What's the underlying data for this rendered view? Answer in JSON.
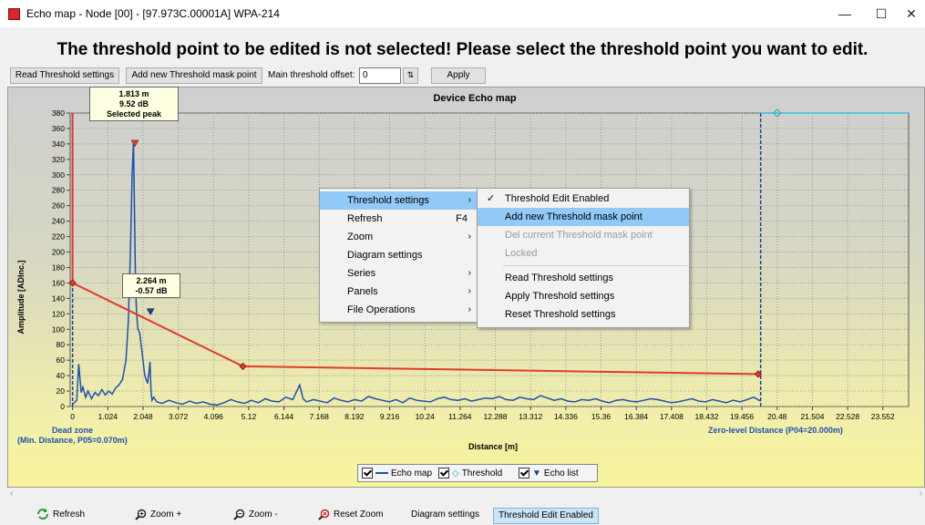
{
  "window": {
    "title": "Echo map - Node [00] - [97.973C.00001A] WPA-214",
    "minimize_glyph": "—",
    "maximize_glyph": "☐",
    "close_glyph": "✕"
  },
  "banner": "The threshold point to be edited is not selected! Please select the threshold point you want to edit.",
  "toolbar": {
    "read_threshold": "Read Threshold settings",
    "add_mask_point": "Add new Threshold mask point",
    "offset_label": "Main threshold offset:",
    "offset_value": "0",
    "apply": "Apply"
  },
  "chart_labels": {
    "dead_zone": "Dead zone",
    "min_distance": "(Min. Distance, P05=0.070m)",
    "zero_level": "Zero-level Distance (P04=20.000m)",
    "selected_peak": {
      "distance": "1.813 m",
      "level": "9.52 dB",
      "caption": "Selected peak"
    },
    "second_peak": {
      "distance": "2.264 m",
      "level": "-0.57 dB"
    }
  },
  "chart_data": {
    "type": "line",
    "title": "Device Echo map",
    "xlabel": "Distance [m]",
    "ylabel": "Amplitude [ADInc.]",
    "xlim": [
      -0.07,
      24.3
    ],
    "ylim": [
      0,
      380
    ],
    "x_ticks": [
      "0",
      "1.024",
      "2.048",
      "3.072",
      "4.096",
      "5.12",
      "6.144",
      "7.168",
      "8.192",
      "9.216",
      "10.24",
      "11.264",
      "12.288",
      "13.312",
      "14.336",
      "15.36",
      "16.384",
      "17.408",
      "18.432",
      "19.456",
      "20.48",
      "21.504",
      "22.528",
      "23.552"
    ],
    "y_ticks": [
      "0",
      "20",
      "40",
      "60",
      "80",
      "100",
      "120",
      "140",
      "160",
      "180",
      "200",
      "220",
      "240",
      "260",
      "280",
      "300",
      "320",
      "340",
      "360",
      "380"
    ],
    "grid": true,
    "series": [
      {
        "name": "Echo map",
        "color": "#1f4fb0",
        "x": [
          0.0,
          0.12,
          0.18,
          0.25,
          0.3,
          0.38,
          0.45,
          0.55,
          0.65,
          0.75,
          0.85,
          0.95,
          1.05,
          1.15,
          1.25,
          1.35,
          1.45,
          1.55,
          1.62,
          1.68,
          1.73,
          1.77,
          1.8,
          1.83,
          1.86,
          1.9,
          1.95,
          2.02,
          2.1,
          2.18,
          2.22,
          2.25,
          2.28,
          2.31,
          2.36,
          2.45,
          2.6,
          2.8,
          3.0,
          3.2,
          3.4,
          3.6,
          3.8,
          4.0,
          4.2,
          4.4,
          4.6,
          4.8,
          5.0,
          5.2,
          5.4,
          5.6,
          5.8,
          6.0,
          6.2,
          6.4,
          6.6,
          6.7,
          6.8,
          7.0,
          7.2,
          7.4,
          7.6,
          7.8,
          8.0,
          8.2,
          8.4,
          8.6,
          8.8,
          9.0,
          9.2,
          9.4,
          9.6,
          9.8,
          10.0,
          10.2,
          10.4,
          10.6,
          10.8,
          11.0,
          11.2,
          11.4,
          11.6,
          11.8,
          12.0,
          12.2,
          12.4,
          12.6,
          12.8,
          13.0,
          13.2,
          13.4,
          13.6,
          13.8,
          14.0,
          14.2,
          14.4,
          14.6,
          14.8,
          15.0,
          15.2,
          15.4,
          15.6,
          15.8,
          16.0,
          16.2,
          16.4,
          16.6,
          16.8,
          17.0,
          17.2,
          17.4,
          17.6,
          17.8,
          18.0,
          18.2,
          18.4,
          18.6,
          18.8,
          19.0,
          19.2,
          19.4,
          19.6,
          19.8,
          20.0
        ],
        "y": [
          3,
          8,
          55,
          18,
          25,
          12,
          20,
          10,
          18,
          14,
          22,
          15,
          20,
          16,
          24,
          28,
          35,
          60,
          110,
          200,
          300,
          345,
          250,
          160,
          120,
          100,
          95,
          70,
          40,
          30,
          45,
          58,
          20,
          8,
          12,
          6,
          4,
          8,
          5,
          3,
          7,
          4,
          6,
          3,
          2,
          5,
          9,
          6,
          4,
          8,
          5,
          10,
          7,
          6,
          12,
          9,
          28,
          10,
          6,
          9,
          7,
          5,
          11,
          8,
          6,
          9,
          7,
          13,
          10,
          8,
          6,
          9,
          5,
          11,
          8,
          7,
          6,
          10,
          12,
          9,
          8,
          10,
          7,
          9,
          11,
          10,
          13,
          9,
          8,
          12,
          10,
          9,
          14,
          11,
          8,
          10,
          7,
          6,
          9,
          8,
          10,
          7,
          5,
          8,
          9,
          7,
          6,
          8,
          10,
          9,
          7,
          5,
          6,
          8,
          10,
          7,
          6,
          9,
          7,
          5,
          8,
          6,
          9,
          12,
          7
        ]
      },
      {
        "name": "Threshold",
        "color": "#e23b2b",
        "x": [
          0.0,
          4.95,
          19.93
        ],
        "y": [
          160,
          52,
          42
        ]
      },
      {
        "name": "Echo list",
        "color": "#1f3f8f",
        "x": [
          1.813,
          2.264
        ],
        "y": [
          340,
          122
        ]
      }
    ],
    "annotations": [
      "1.813 m 9.52 dB Selected peak",
      "2.264 m -0.57 dB"
    ],
    "legend": {
      "position": "bottom-center",
      "entries": [
        "Echo map",
        "Threshold",
        "Echo list"
      ]
    }
  },
  "context_menu": {
    "items": [
      {
        "label": "Threshold settings",
        "arrow": "›",
        "highlighted": true
      },
      {
        "label": "Refresh",
        "shortcut": "F4"
      },
      {
        "label": "Zoom",
        "arrow": "›"
      },
      {
        "label": "Diagram settings"
      },
      {
        "label": "Series",
        "arrow": "›"
      },
      {
        "label": "Panels",
        "arrow": "›"
      },
      {
        "label": "File Operations",
        "arrow": "›"
      }
    ],
    "submenu": [
      {
        "label": "Threshold Edit Enabled",
        "checked": "✓"
      },
      {
        "label": "Add new Threshold mask point",
        "highlighted": true
      },
      {
        "label": "Del current Threshold mask point",
        "disabled": true
      },
      {
        "label": "Locked",
        "disabled": true
      },
      {
        "label": "Read Threshold settings"
      },
      {
        "label": "Apply Threshold settings"
      },
      {
        "label": "Reset Threshold settings"
      }
    ]
  },
  "bottom": {
    "refresh": "Refresh",
    "zoom_in": "Zoom +",
    "zoom_out": "Zoom -",
    "reset_zoom": "Reset Zoom",
    "diagram_settings": "Diagram settings",
    "threshold_edit": "Threshold Edit Enabled"
  }
}
